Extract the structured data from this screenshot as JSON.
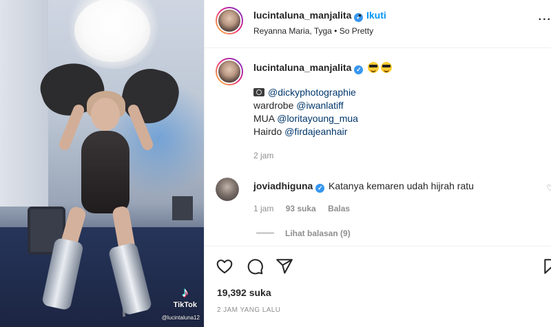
{
  "post": {
    "author": "lucintaluna_manjalita",
    "follow_label": "Ikuti",
    "separator": "•",
    "audio": "Reyanna Maria, Tyga • So Pretty",
    "more": "..."
  },
  "media": {
    "watermark_app": "TikTok",
    "watermark_user": "@lucintaluna12"
  },
  "caption": {
    "author": "lucintaluna_manjalita",
    "credit_line_1_mention": "@dickyphotographie",
    "credit_line_2_label": "wardrobe",
    "credit_line_2_mention": "@iwanlatiff",
    "credit_line_3_label": "MUA",
    "credit_line_3_mention": "@loritayoung_mua",
    "credit_line_4_label": "Hairdo",
    "credit_line_4_mention": "@firdajeanhair",
    "time": "2 jam"
  },
  "comment": {
    "author": "joviadhiguna",
    "text": "Katanya kemaren udah hijrah ratu",
    "time": "1 jam",
    "likes": "93 suka",
    "reply_label": "Balas",
    "view_replies": "Lihat balasan (9)"
  },
  "footer": {
    "likes": "19,392 suka",
    "posted": "2 JAM YANG LALU"
  },
  "icons": {
    "verified": "verified-badge-icon",
    "like": "heart-icon",
    "comment": "comment-bubble-icon",
    "share": "paper-plane-icon",
    "save": "bookmark-icon",
    "camera": "camera-icon",
    "emoji": "sunglasses-emoji-icon"
  },
  "colors": {
    "link": "#0095f6",
    "mention": "#00376b",
    "verified": "#3897f0",
    "muted": "#8e8e8e"
  }
}
